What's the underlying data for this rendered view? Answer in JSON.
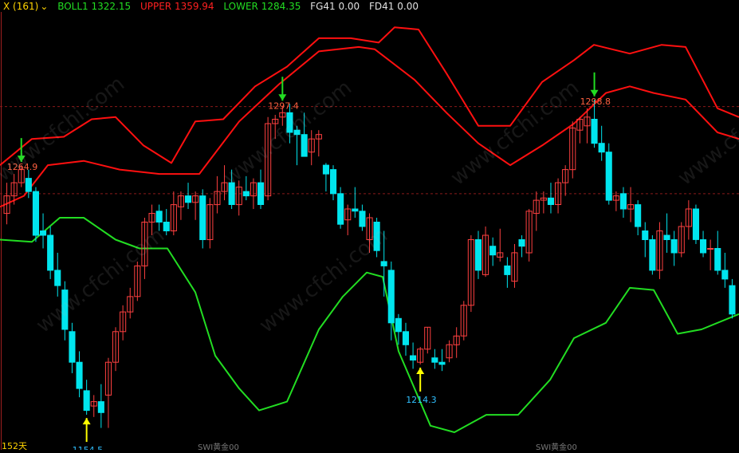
{
  "header": {
    "indicator": "X (161)",
    "boll_label": "BOLL1 1322.15",
    "upper_label": "UPPER 1359.94",
    "lower_label": "LOWER 1284.35",
    "fg_label": "FG41 0.00",
    "fd_label": "FD41 0.00"
  },
  "watermark": "www.cfchi.com",
  "footer": {
    "left_partial": "152天",
    "label_a": "SWI黄金00",
    "label_b": "SWI黄金00"
  },
  "colors": {
    "background": "#000000",
    "up_candle": "#ff4040",
    "down_candle": "#00e5ee",
    "boll_mid": "#ff1010",
    "upper_band": "#ff1010",
    "lower_band": "#22dd22",
    "grid_dashed": "#8b1a1a",
    "marker_down": "#22dd22",
    "marker_up": "#ffff00",
    "annot_high": "#ff6040",
    "annot_low": "#30c0ff"
  },
  "chart_data": {
    "type": "candlestick",
    "title": "",
    "price_scale": {
      "ymin": 1140,
      "ymax": 1340
    },
    "reference_levels": [
      1296.8,
      1257.0
    ],
    "candles": [
      [
        1248,
        1262,
        1243,
        1256
      ],
      [
        1256,
        1266,
        1252,
        1262
      ],
      [
        1262,
        1270,
        1260,
        1268
      ],
      [
        1264,
        1268,
        1255,
        1258
      ],
      [
        1258,
        1260,
        1235,
        1238
      ],
      [
        1240,
        1248,
        1232,
        1238
      ],
      [
        1238,
        1242,
        1218,
        1222
      ],
      [
        1222,
        1230,
        1210,
        1215
      ],
      [
        1213,
        1217,
        1190,
        1195
      ],
      [
        1194,
        1198,
        1175,
        1180
      ],
      [
        1180,
        1185,
        1164,
        1168
      ],
      [
        1167,
        1172,
        1156,
        1158
      ],
      [
        1160,
        1165,
        1155,
        1162
      ],
      [
        1162,
        1170,
        1150,
        1157
      ],
      [
        1165,
        1182,
        1150,
        1180
      ],
      [
        1180,
        1196,
        1176,
        1194
      ],
      [
        1194,
        1206,
        1190,
        1203
      ],
      [
        1203,
        1214,
        1200,
        1210
      ],
      [
        1210,
        1226,
        1208,
        1224
      ],
      [
        1224,
        1246,
        1218,
        1244
      ],
      [
        1244,
        1252,
        1238,
        1248
      ],
      [
        1249,
        1252,
        1240,
        1244
      ],
      [
        1244,
        1250,
        1238,
        1240
      ],
      [
        1240,
        1258,
        1238,
        1252
      ],
      [
        1251,
        1258,
        1245,
        1256
      ],
      [
        1256,
        1262,
        1250,
        1253
      ],
      [
        1253,
        1258,
        1245,
        1256
      ],
      [
        1256,
        1259,
        1232,
        1236
      ],
      [
        1236,
        1255,
        1232,
        1252
      ],
      [
        1252,
        1265,
        1248,
        1258
      ],
      [
        1258,
        1270,
        1254,
        1262
      ],
      [
        1262,
        1268,
        1250,
        1252
      ],
      [
        1252,
        1263,
        1247,
        1260
      ],
      [
        1258,
        1265,
        1254,
        1256
      ],
      [
        1256,
        1264,
        1250,
        1262
      ],
      [
        1262,
        1268,
        1250,
        1252
      ],
      [
        1256,
        1292,
        1254,
        1289
      ],
      [
        1289,
        1293,
        1282,
        1291
      ],
      [
        1292,
        1297,
        1288,
        1294
      ],
      [
        1294,
        1298,
        1280,
        1285
      ],
      [
        1286,
        1288,
        1270,
        1284
      ],
      [
        1284,
        1294,
        1274,
        1274
      ],
      [
        1276,
        1286,
        1270,
        1282
      ],
      [
        1282,
        1286,
        1274,
        1284
      ],
      [
        1270,
        1271,
        1258,
        1266
      ],
      [
        1268,
        1270,
        1254,
        1257
      ],
      [
        1257,
        1260,
        1241,
        1243
      ],
      [
        1245,
        1252,
        1238,
        1250
      ],
      [
        1250,
        1260,
        1246,
        1249
      ],
      [
        1249,
        1252,
        1240,
        1242
      ],
      [
        1236,
        1248,
        1230,
        1246
      ],
      [
        1244,
        1246,
        1228,
        1231
      ],
      [
        1226,
        1240,
        1210,
        1224
      ],
      [
        1222,
        1226,
        1190,
        1198
      ],
      [
        1200,
        1202,
        1188,
        1194
      ],
      [
        1194,
        1198,
        1183,
        1188
      ],
      [
        1183,
        1189,
        1177,
        1181
      ],
      [
        1180,
        1187,
        1179,
        1186
      ],
      [
        1186,
        1196,
        1184,
        1196
      ],
      [
        1182,
        1186,
        1177,
        1180
      ],
      [
        1180,
        1186,
        1176,
        1179
      ],
      [
        1182,
        1190,
        1180,
        1188
      ],
      [
        1188,
        1196,
        1182,
        1192
      ],
      [
        1192,
        1208,
        1190,
        1206
      ],
      [
        1206,
        1238,
        1203,
        1236
      ],
      [
        1236,
        1240,
        1218,
        1222
      ],
      [
        1220,
        1242,
        1219,
        1238
      ],
      [
        1233,
        1237,
        1224,
        1229
      ],
      [
        1228,
        1241,
        1226,
        1230
      ],
      [
        1224,
        1228,
        1214,
        1220
      ],
      [
        1217,
        1234,
        1214,
        1230
      ],
      [
        1236,
        1238,
        1228,
        1233
      ],
      [
        1230,
        1250,
        1226,
        1249
      ],
      [
        1248,
        1258,
        1240,
        1254
      ],
      [
        1254,
        1258,
        1248,
        1255
      ],
      [
        1255,
        1262,
        1248,
        1252
      ],
      [
        1252,
        1264,
        1248,
        1262
      ],
      [
        1262,
        1270,
        1256,
        1268
      ],
      [
        1268,
        1290,
        1264,
        1287
      ],
      [
        1286,
        1292,
        1280,
        1291
      ],
      [
        1288,
        1296,
        1280,
        1292
      ],
      [
        1291,
        1300,
        1278,
        1280
      ],
      [
        1280,
        1288,
        1272,
        1276
      ],
      [
        1276,
        1280,
        1252,
        1254
      ],
      [
        1254,
        1258,
        1249,
        1256
      ],
      [
        1257,
        1260,
        1246,
        1250
      ],
      [
        1250,
        1260,
        1244,
        1252
      ],
      [
        1252,
        1254,
        1238,
        1242
      ],
      [
        1240,
        1244,
        1228,
        1236
      ],
      [
        1236,
        1238,
        1220,
        1222
      ],
      [
        1222,
        1244,
        1218,
        1240
      ],
      [
        1238,
        1248,
        1230,
        1236
      ],
      [
        1236,
        1240,
        1224,
        1230
      ],
      [
        1230,
        1244,
        1228,
        1242
      ],
      [
        1242,
        1254,
        1236,
        1250
      ],
      [
        1250,
        1252,
        1234,
        1236
      ],
      [
        1236,
        1240,
        1228,
        1230
      ],
      [
        1232,
        1236,
        1222,
        1232
      ],
      [
        1232,
        1240,
        1220,
        1222
      ],
      [
        1222,
        1230,
        1214,
        1218
      ],
      [
        1215,
        1218,
        1200,
        1202
      ]
    ],
    "boll_mid": [
      [
        0,
        1251
      ],
      [
        30,
        1256
      ],
      [
        60,
        1270
      ],
      [
        105,
        1272
      ],
      [
        150,
        1268
      ],
      [
        200,
        1266
      ],
      [
        250,
        1266
      ],
      [
        300,
        1290
      ],
      [
        350,
        1307
      ],
      [
        400,
        1322
      ],
      [
        450,
        1324
      ],
      [
        470,
        1323
      ],
      [
        520,
        1309
      ],
      [
        560,
        1294
      ],
      [
        600,
        1280
      ],
      [
        640,
        1270
      ],
      [
        680,
        1279
      ],
      [
        720,
        1289
      ],
      [
        760,
        1303
      ],
      [
        790,
        1306
      ],
      [
        820,
        1303
      ],
      [
        860,
        1300
      ],
      [
        900,
        1285
      ],
      [
        927,
        1282
      ]
    ],
    "upper_band": [
      [
        0,
        1270
      ],
      [
        40,
        1282
      ],
      [
        80,
        1283
      ],
      [
        115,
        1291
      ],
      [
        145,
        1292
      ],
      [
        180,
        1279
      ],
      [
        215,
        1271
      ],
      [
        245,
        1290
      ],
      [
        280,
        1291
      ],
      [
        320,
        1306
      ],
      [
        360,
        1315
      ],
      [
        400,
        1328
      ],
      [
        440,
        1328
      ],
      [
        475,
        1326
      ],
      [
        495,
        1333
      ],
      [
        525,
        1332
      ],
      [
        560,
        1312
      ],
      [
        600,
        1288
      ],
      [
        640,
        1288
      ],
      [
        680,
        1308
      ],
      [
        720,
        1318
      ],
      [
        745,
        1325
      ],
      [
        790,
        1321
      ],
      [
        830,
        1325
      ],
      [
        860,
        1324
      ],
      [
        900,
        1296
      ],
      [
        927,
        1292
      ]
    ],
    "lower_band": [
      [
        0,
        1236
      ],
      [
        40,
        1235
      ],
      [
        75,
        1246
      ],
      [
        105,
        1246
      ],
      [
        145,
        1236
      ],
      [
        175,
        1232
      ],
      [
        210,
        1232
      ],
      [
        245,
        1212
      ],
      [
        270,
        1183
      ],
      [
        300,
        1168
      ],
      [
        325,
        1158
      ],
      [
        360,
        1162
      ],
      [
        400,
        1195
      ],
      [
        430,
        1210
      ],
      [
        460,
        1221
      ],
      [
        480,
        1219
      ],
      [
        500,
        1185
      ],
      [
        540,
        1151
      ],
      [
        570,
        1148
      ],
      [
        610,
        1156
      ],
      [
        650,
        1156
      ],
      [
        690,
        1172
      ],
      [
        720,
        1191
      ],
      [
        760,
        1198
      ],
      [
        790,
        1214
      ],
      [
        820,
        1213
      ],
      [
        850,
        1193
      ],
      [
        880,
        1195
      ],
      [
        927,
        1202
      ]
    ],
    "annotations": [
      {
        "text": "1264.9",
        "kind": "high",
        "candle": 2,
        "price": 1270
      },
      {
        "text": "1297.4",
        "kind": "high",
        "candle": 38,
        "price": 1298
      },
      {
        "text": "1298.8",
        "kind": "high",
        "candle": 81,
        "price": 1300
      },
      {
        "text": "1214.3",
        "kind": "low",
        "candle": 57,
        "price": 1179
      },
      {
        "text": "1154.5",
        "kind": "low",
        "candle": 11,
        "price": 1156
      }
    ]
  }
}
